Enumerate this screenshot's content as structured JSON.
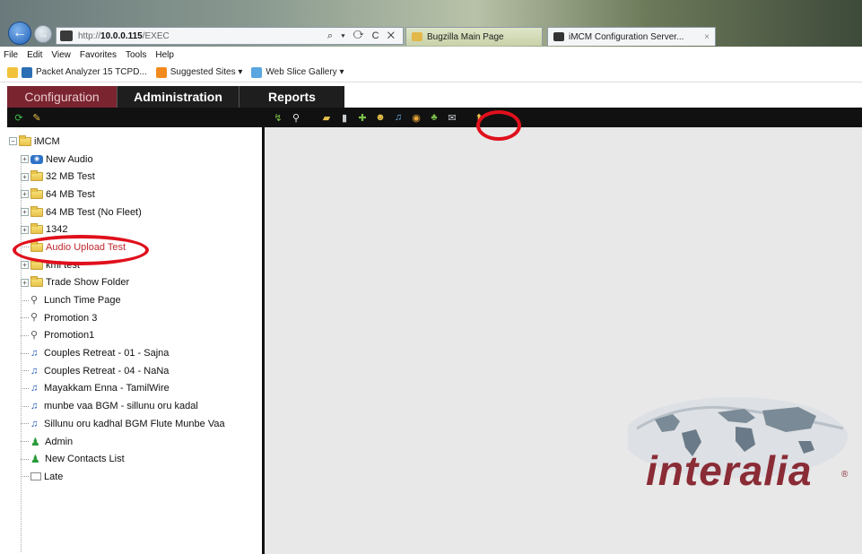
{
  "browser": {
    "url_host": "10.0.0.115",
    "url_prefix": "http://",
    "url_rest": "/EXEC",
    "addr_tools": "⌕ ▾ ⟳ C ✕",
    "tabs": [
      {
        "label": "Bugzilla Main Page"
      },
      {
        "label": "iMCM Configuration Server...",
        "close": "×"
      }
    ]
  },
  "menubar": [
    "File",
    "Edit",
    "View",
    "Favorites",
    "Tools",
    "Help"
  ],
  "favorites": [
    {
      "label": "Packet Analyzer 15 TCPD..."
    },
    {
      "label": "Suggested Sites ▾"
    },
    {
      "label": "Web Slice Gallery ▾"
    }
  ],
  "app_tabs": {
    "configuration": "Configuration",
    "administration": "Administration",
    "reports": "Reports"
  },
  "tree": {
    "root": "iMCM",
    "items": [
      {
        "label": "New Audio",
        "type": "audio-folder",
        "expandable": true
      },
      {
        "label": "32 MB Test",
        "type": "folder",
        "expandable": true
      },
      {
        "label": "64 MB Test",
        "type": "folder",
        "expandable": true
      },
      {
        "label": "64 MB Test (No Fleet)",
        "type": "folder",
        "expandable": true
      },
      {
        "label": "1342",
        "type": "folder",
        "expandable": true
      },
      {
        "label": "Audio Upload Test",
        "type": "folder",
        "expandable": false
      },
      {
        "label": "kmi test",
        "type": "folder",
        "expandable": true
      },
      {
        "label": "Trade Show Folder",
        "type": "folder",
        "expandable": true
      },
      {
        "label": "Lunch Time Page",
        "type": "page"
      },
      {
        "label": "Promotion 3",
        "type": "page"
      },
      {
        "label": "Promotion1",
        "type": "page"
      },
      {
        "label": "Couples Retreat - 01 - Sajna",
        "type": "audio"
      },
      {
        "label": "Couples Retreat - 04 - NaNa",
        "type": "audio"
      },
      {
        "label": "Mayakkam Enna - TamilWire",
        "type": "audio"
      },
      {
        "label": "munbe vaa BGM - sillunu oru kadal",
        "type": "audio"
      },
      {
        "label": "Sillunu oru kadhal BGM Flute Munbe Vaa",
        "type": "audio"
      },
      {
        "label": "Admin",
        "type": "user"
      },
      {
        "label": "New Contacts List",
        "type": "user"
      },
      {
        "label": "Late",
        "type": "mail"
      }
    ]
  },
  "logo": {
    "text": "interalia",
    "mark": "®"
  },
  "colors": {
    "config_tab": "#7a2430",
    "highlight": "#e0101c",
    "logo": "#8a2c36"
  }
}
